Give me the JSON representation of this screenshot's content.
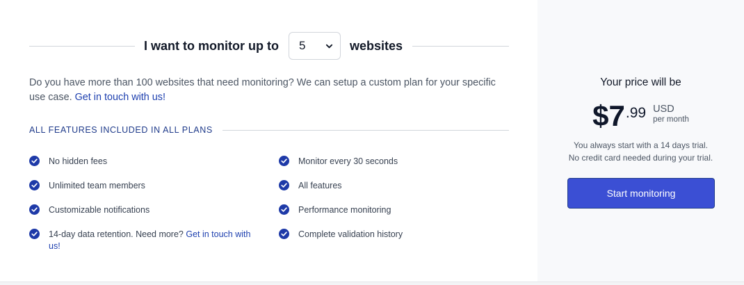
{
  "monitor": {
    "prefix": "I want to monitor up to",
    "selected_count": "5",
    "suffix": "websites"
  },
  "description": {
    "text": "Do you have more than 100 websites that need monitoring? We can setup a custom plan for your specific use case.",
    "link": "Get in touch with us!"
  },
  "features": {
    "title": "ALL FEATURES INCLUDED IN ALL PLANS",
    "column1": [
      {
        "text": "No hidden fees"
      },
      {
        "text": "Unlimited team members"
      },
      {
        "text": "Customizable notifications"
      },
      {
        "text": "14-day data retention. Need more?",
        "link": "Get in touch with us!"
      }
    ],
    "column2": [
      {
        "text": "Monitor every 30 seconds"
      },
      {
        "text": "All features"
      },
      {
        "text": "Performance monitoring"
      },
      {
        "text": "Complete validation history"
      }
    ],
    "check_icon": "check-circle-icon",
    "check_color": "#1e3aa8"
  },
  "pricing": {
    "label": "Your price will be",
    "dollars": "$7",
    "cents": ".99",
    "currency": "USD",
    "period": "per month",
    "trial_line1": "You always start with a 14 days trial.",
    "trial_line2": "No credit card needed during your trial.",
    "cta_label": "Start monitoring",
    "cta_color": "#3b4fd4"
  }
}
